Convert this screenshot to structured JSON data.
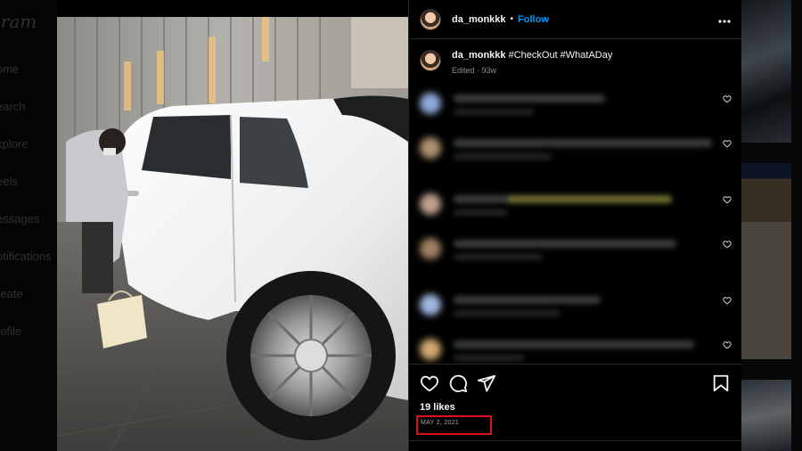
{
  "sidebar": {
    "logo": "gram",
    "items": [
      {
        "label": "ome"
      },
      {
        "label": "earch"
      },
      {
        "label": "xplore"
      },
      {
        "label": "eels"
      },
      {
        "label": "essages"
      },
      {
        "label": "otifications"
      },
      {
        "label": "reate"
      },
      {
        "label": "rofile"
      }
    ]
  },
  "post": {
    "username": "da_monkkk",
    "follow_label": "Follow",
    "separator": "•",
    "more_icon": "more-horizontal-icon",
    "caption_user": "da_monkkk",
    "caption_text": "#CheckOut #WhatADay",
    "caption_meta": "Edited · 93w",
    "likes": "19 likes",
    "date": "MAY 2, 2021",
    "image_alt_subject": "white luxury car"
  },
  "comments": [
    {
      "avatar_color": "#8fa8d8"
    },
    {
      "avatar_color": "#b09070"
    },
    {
      "avatar_color": "#c0a090"
    },
    {
      "avatar_color": "#a08060"
    },
    {
      "avatar_color": "#a0b8e0"
    },
    {
      "avatar_color": "#d0a870"
    }
  ],
  "colors": {
    "accent": "#0095f6",
    "highlight_box": "#e0101a",
    "panel_bg": "#000000"
  }
}
